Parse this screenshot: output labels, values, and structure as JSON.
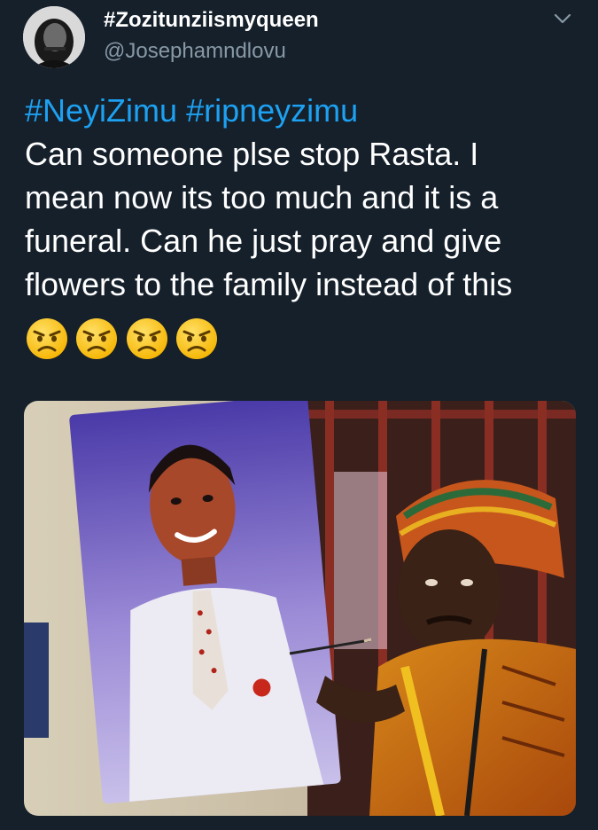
{
  "tweet": {
    "display_name": "#Zozitunziismyqueen",
    "handle": "@Josephamndlovu",
    "hashtags": [
      "#NeyiZimu",
      "#ripneyzimu"
    ],
    "text_lines": [
      "Can someone plse stop Rasta. I",
      "mean now its too much and it is a",
      "funeral. Can he just pray and give",
      "flowers to the family instead of this"
    ],
    "emojis": [
      "angry-face",
      "angry-face",
      "angry-face",
      "angry-face"
    ]
  },
  "colors": {
    "background": "#15202b",
    "hashtag": "#1da1f2",
    "handle": "#8899a6",
    "text": "#ffffff"
  },
  "icons": {
    "menu": "chevron-down-icon",
    "emoji": "angry-face-icon"
  }
}
